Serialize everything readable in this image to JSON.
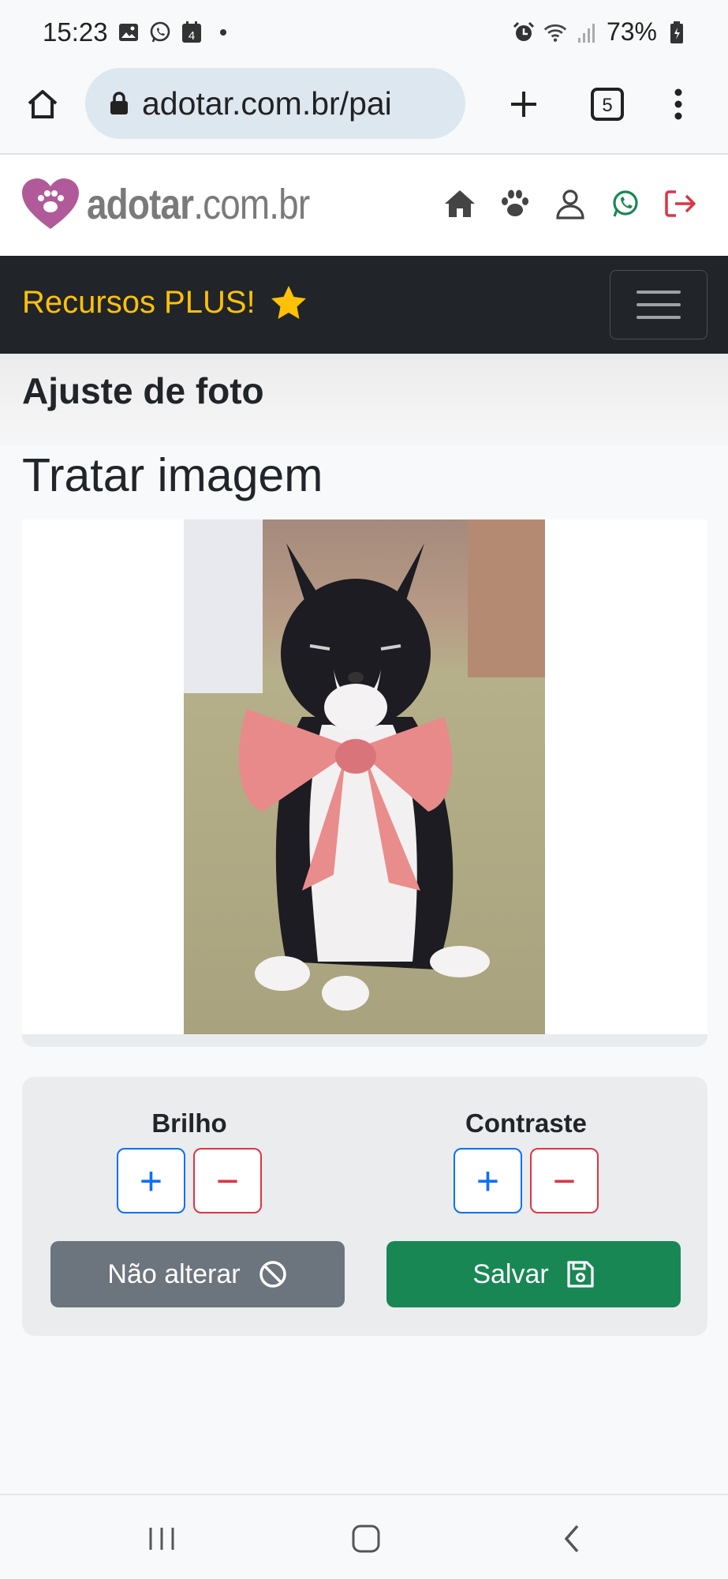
{
  "status_bar": {
    "time": "15:23",
    "notification_badge": "4",
    "battery": "73%",
    "icons": [
      "image-icon",
      "whatsapp-icon",
      "calendar-icon",
      "dot-icon",
      "alarm-icon",
      "wifi-icon",
      "signal-icon",
      "battery-icon"
    ]
  },
  "browser": {
    "url": "adotar.com.br/pai",
    "tab_count": "5",
    "icons": [
      "home-icon",
      "lock-icon",
      "new-tab-icon",
      "tabs-icon",
      "more-icon"
    ]
  },
  "site_header": {
    "logo_main": "adotar",
    "logo_domain": ".com.br",
    "icons": [
      "home-icon",
      "paw-icon",
      "user-icon",
      "whatsapp-icon",
      "logout-icon"
    ],
    "colors": {
      "logo_heart": "#b05a9a",
      "whatsapp": "#198754",
      "logout": "#dc3545",
      "icons": "#444444"
    }
  },
  "navbar": {
    "brand": "Recursos PLUS!",
    "colors": {
      "brand": "#ffc107",
      "background": "#212529"
    }
  },
  "page": {
    "header_title": "Ajuste de foto",
    "section_title": "Tratar imagem"
  },
  "controls": {
    "brightness": {
      "label": "Brilho",
      "plus": "+",
      "minus": "−"
    },
    "contrast": {
      "label": "Contraste",
      "plus": "+",
      "minus": "−"
    },
    "cancel_label": "Não alterar",
    "save_label": "Salvar",
    "colors": {
      "plus": "#0d6efd",
      "minus": "#dc3545",
      "cancel": "#6c757d",
      "save": "#198754"
    }
  }
}
